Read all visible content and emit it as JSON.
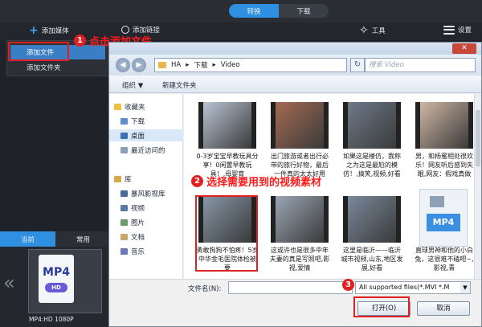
{
  "mode_tabs": [
    {
      "label": "转换",
      "active": true
    },
    {
      "label": "下载",
      "active": false
    }
  ],
  "toolbar": {
    "add_media": "添加媒体",
    "add_link": "添加链接",
    "tools": "工具",
    "settings": "设置"
  },
  "dropdown": {
    "items": [
      "添加文件",
      "添加文件夹"
    ]
  },
  "steps": [
    {
      "num": "1",
      "text": "点击添加文件"
    },
    {
      "num": "2",
      "text": "选择需要用到的视频素材"
    },
    {
      "num": "3",
      "text": ""
    }
  ],
  "presets": {
    "tabs": [
      "当前",
      "常用"
    ],
    "card_format": "MP4",
    "card_badge": "HD",
    "card_label": "MP4:HD 1080P"
  },
  "dialog": {
    "path": [
      "HA",
      "下载",
      "Video"
    ],
    "search_placeholder": "搜索 Video",
    "commands": {
      "organize": "组织 ▼",
      "new_folder": "新建文件夹"
    },
    "nav": [
      {
        "label": "收藏夹",
        "indent": false,
        "selected": false
      },
      {
        "label": "下载",
        "indent": true,
        "selected": false
      },
      {
        "label": "桌面",
        "indent": true,
        "selected": true
      },
      {
        "label": "最近访问的",
        "indent": true,
        "selected": false
      },
      {
        "label": "库",
        "indent": false,
        "selected": false
      },
      {
        "label": "暴风影视库",
        "indent": true,
        "selected": false
      },
      {
        "label": "视频",
        "indent": true,
        "selected": false
      },
      {
        "label": "图片",
        "indent": true,
        "selected": false
      },
      {
        "label": "文档",
        "indent": true,
        "selected": false
      },
      {
        "label": "音乐",
        "indent": true,
        "selected": false
      }
    ],
    "files": [
      {
        "name": "0-3岁宝宝早教玩具分享！0闲置早教玩具！,母婴育",
        "color": "#b8c4d4"
      },
      {
        "name": "出门旅游或者出行必带的旅行好物，最后一件真的太太好用",
        "color": "#a46a52"
      },
      {
        "name": "如果这是楼仿，我称之为这是最尬的模仿！,搞笑,视频,好看",
        "color": "#6e7a8a"
      },
      {
        "name": "男，和杨蜜相处很欢乐！网友听后感到失眠,网友：假戏真做",
        "color": "#d0b6a4"
      },
      {
        "name": "勇敢狗狗不怕疼！5岁中华金毛医院体检被要",
        "color": "#8797a8"
      },
      {
        "name": "这或许也是很多中年夫妻的真是写照吧,影视,爱情",
        "color": "#9aa6b4"
      },
      {
        "name": "这里是临沂——临沂城市视频,山东,地区发展,好看",
        "color": "#7a8a9c"
      },
      {
        "name": "直球男神和他的小白兔，这很难不磕吧~,影视,青",
        "color": "#b48a7a"
      }
    ],
    "mp4_file_label": "MP4",
    "file_name_label": "文件名(N):",
    "filter": "All supported files(*.MVI *.M",
    "open_button": "打开(O)",
    "cancel_button": "取消",
    "close_symbol": "✕"
  },
  "colors": {
    "accent": "#2f8fe0",
    "annotation_red": "#e02020"
  }
}
